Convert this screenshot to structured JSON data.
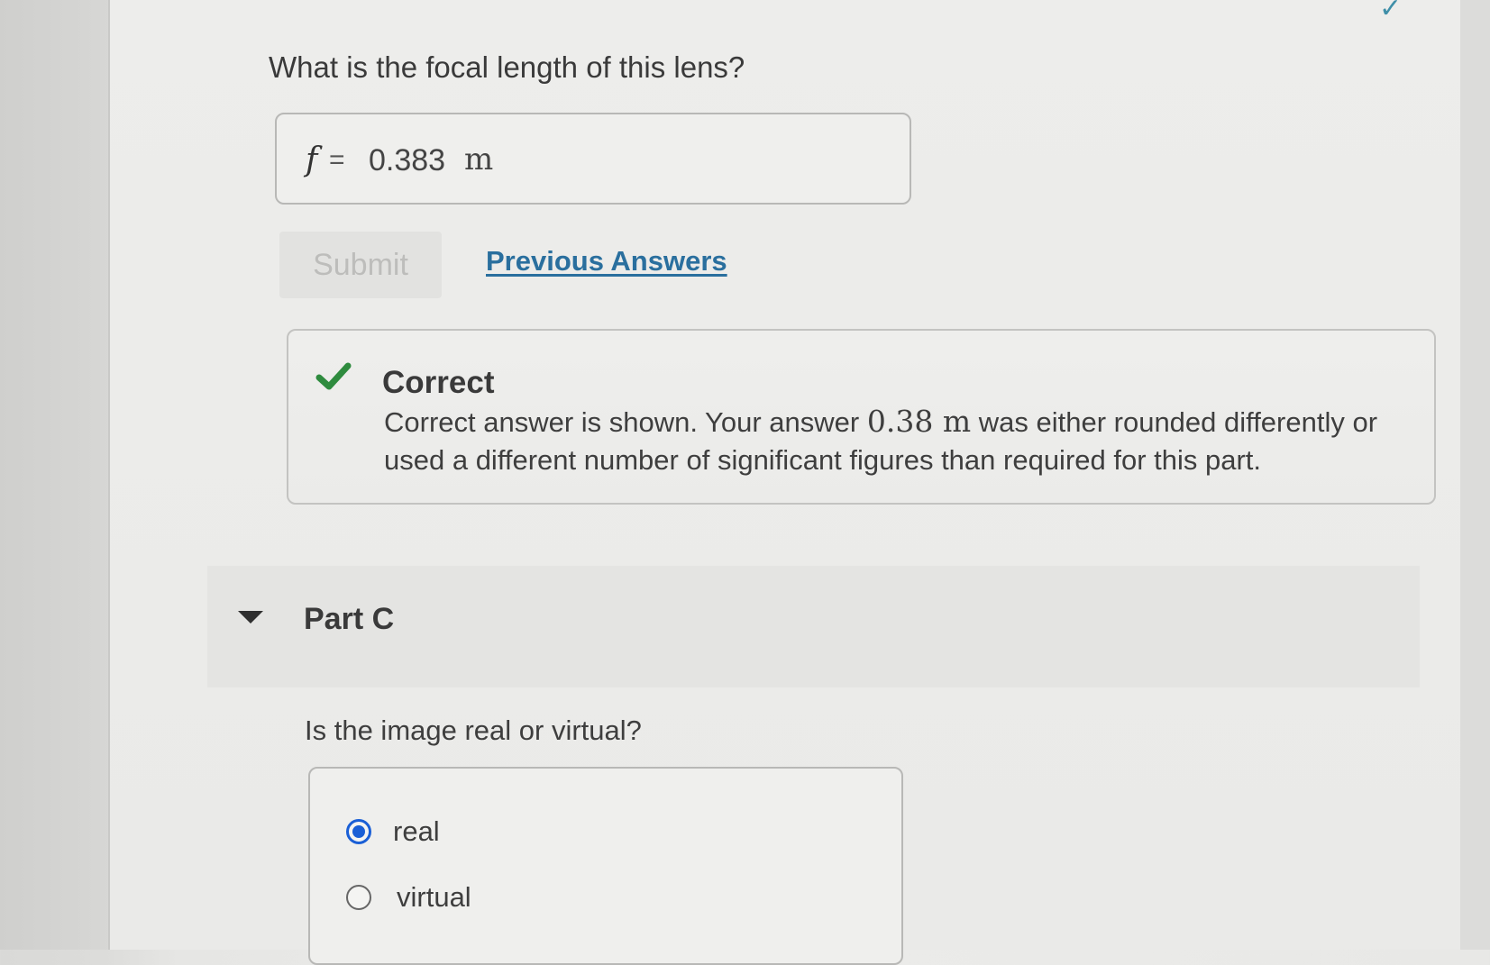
{
  "partB": {
    "question": "What is the focal length of this lens?",
    "answer": {
      "variable": "f",
      "equals": "=",
      "value": "0.383",
      "unit": "m"
    },
    "submit_label": "Submit",
    "previous_answers_label": "Previous Answers",
    "feedback": {
      "title": "Correct",
      "text_before": "Correct answer is shown. Your answer ",
      "answer_value": "0.38 m",
      "text_after": " was either rounded differently or used a different number of significant figures than required for this part."
    }
  },
  "partC": {
    "title": "Part C",
    "question": "Is the image real or virtual?",
    "options": [
      {
        "label": "real",
        "selected": true
      },
      {
        "label": "virtual",
        "selected": false
      }
    ]
  },
  "colors": {
    "link": "#2a6f9e",
    "check": "#2e8b3e",
    "radio_selected": "#1a5fd6"
  }
}
